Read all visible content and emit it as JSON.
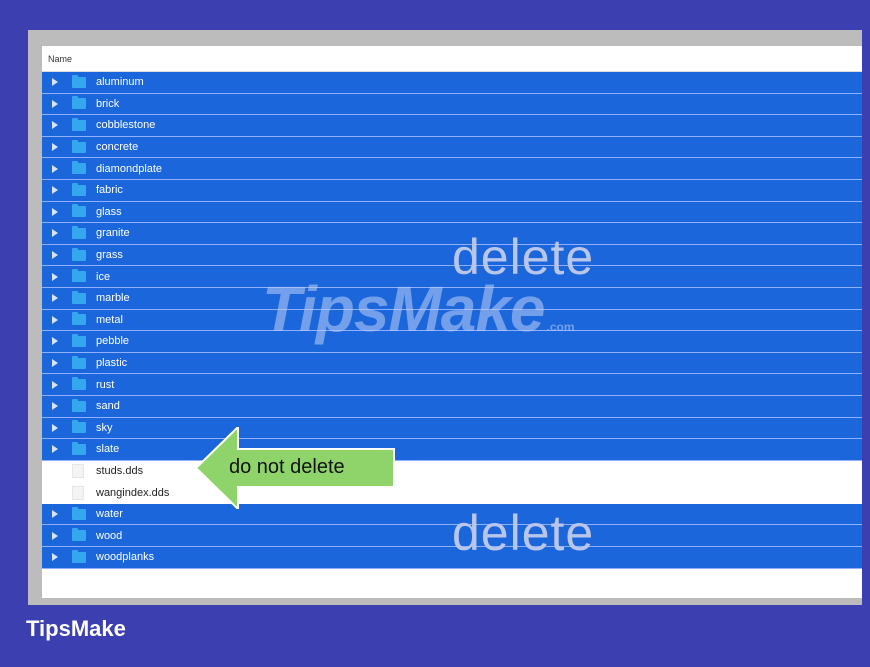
{
  "file_list": {
    "column_header": "Name",
    "rows": [
      {
        "name": "aluminum",
        "type": "folder",
        "selected": true
      },
      {
        "name": "brick",
        "type": "folder",
        "selected": true
      },
      {
        "name": "cobblestone",
        "type": "folder",
        "selected": true
      },
      {
        "name": "concrete",
        "type": "folder",
        "selected": true
      },
      {
        "name": "diamondplate",
        "type": "folder",
        "selected": true
      },
      {
        "name": "fabric",
        "type": "folder",
        "selected": true
      },
      {
        "name": "glass",
        "type": "folder",
        "selected": true
      },
      {
        "name": "granite",
        "type": "folder",
        "selected": true
      },
      {
        "name": "grass",
        "type": "folder",
        "selected": true
      },
      {
        "name": "ice",
        "type": "folder",
        "selected": true
      },
      {
        "name": "marble",
        "type": "folder",
        "selected": true
      },
      {
        "name": "metal",
        "type": "folder",
        "selected": true
      },
      {
        "name": "pebble",
        "type": "folder",
        "selected": true
      },
      {
        "name": "plastic",
        "type": "folder",
        "selected": true
      },
      {
        "name": "rust",
        "type": "folder",
        "selected": true
      },
      {
        "name": "sand",
        "type": "folder",
        "selected": true
      },
      {
        "name": "sky",
        "type": "folder",
        "selected": true
      },
      {
        "name": "slate",
        "type": "folder",
        "selected": true
      },
      {
        "name": "studs.dds",
        "type": "file",
        "selected": false
      },
      {
        "name": "wangindex.dds",
        "type": "file",
        "selected": false
      },
      {
        "name": "water",
        "type": "folder",
        "selected": true
      },
      {
        "name": "wood",
        "type": "folder",
        "selected": true
      },
      {
        "name": "woodplanks",
        "type": "folder",
        "selected": true
      }
    ]
  },
  "annotations": {
    "delete_top": "delete",
    "delete_bottom": "delete",
    "do_not_delete": "do not delete"
  },
  "watermark": {
    "text": "TipsMake",
    "suffix": ".com"
  },
  "brand": "TipsMake",
  "colors": {
    "background": "#3b3fb0",
    "selection": "#1b66db",
    "folder": "#35a7ef",
    "arrow": "#8fd46a"
  }
}
